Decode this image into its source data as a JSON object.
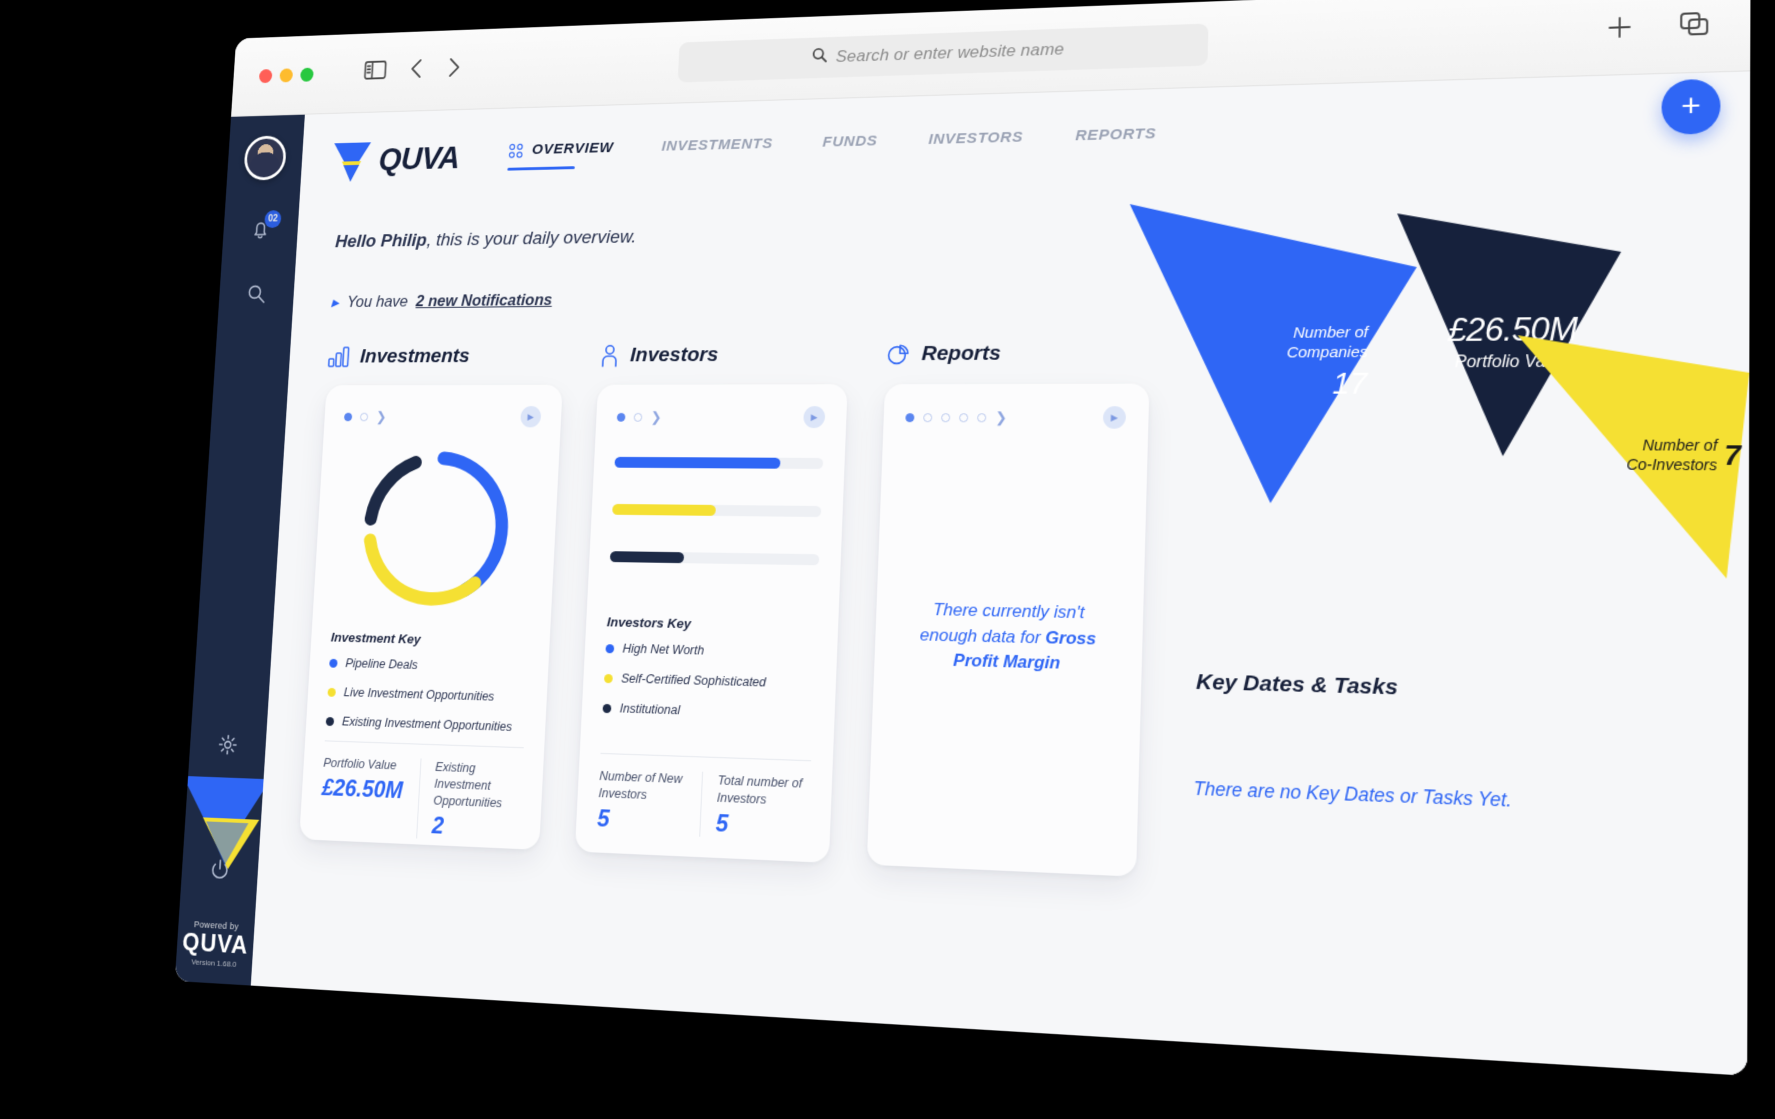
{
  "browser": {
    "search": {
      "placeholder": "Search or enter website name",
      "icon": "search-icon"
    },
    "sidebar_toggle_icon": "sidebar-toggle-icon",
    "back_icon": "chevron-left-icon",
    "forward_icon": "chevron-right-icon",
    "new_tab_icon": "plus-icon",
    "tab_overview_icon": "copy-tabs-icon"
  },
  "rail": {
    "avatar": "user-avatar",
    "notifications_badge": "02",
    "bell_icon": "bell-icon",
    "search_icon": "search-icon",
    "settings_icon": "gear-icon",
    "help_icon": "help-icon",
    "logout_icon": "logout-icon",
    "powered_by": "Powered by",
    "logo_name": "QUVA",
    "version": "Version 1.68.0"
  },
  "header": {
    "brand": "QUVA",
    "fab_label": "+",
    "tabs": [
      {
        "label": "OVERVIEW",
        "icon": "grid-icon",
        "active": true
      },
      {
        "label": "INVESTMENTS",
        "active": false
      },
      {
        "label": "FUNDS",
        "active": false
      },
      {
        "label": "INVESTORS",
        "active": false
      },
      {
        "label": "REPORTS",
        "active": false
      }
    ]
  },
  "greeting": {
    "name": "Hello Philip",
    "rest": ", this is your daily overview.",
    "notif_prefix": "You have ",
    "notif_link": "2 new Notifications"
  },
  "investments": {
    "title": "Investments",
    "icon": "bar-chart-icon",
    "carousel": {
      "dots": 2,
      "active": 0,
      "next_icon": "chevron-right-icon",
      "play_icon": "play-icon"
    },
    "legend_title": "Investment Key",
    "legend": [
      {
        "label": "Pipeline Deals",
        "color": "#2f66f5"
      },
      {
        "label": "Live Investment Opportunities",
        "color": "#f5e033"
      },
      {
        "label": "Existing Investment Opportunities",
        "color": "#1d2a46"
      }
    ],
    "stats": [
      {
        "label": "Portfolio Value",
        "value": "£26.50M"
      },
      {
        "label": "Existing Investment Opportunities",
        "value": "2"
      }
    ]
  },
  "investors": {
    "title": "Investors",
    "icon": "person-icon",
    "carousel": {
      "dots": 2,
      "active": 0,
      "next_icon": "chevron-right-icon",
      "play_icon": "play-icon"
    },
    "legend_title": "Investors Key",
    "legend": [
      {
        "label": "High Net Worth",
        "color": "#2f66f5"
      },
      {
        "label": "Self-Certified Sophisticated",
        "color": "#f5e033"
      },
      {
        "label": "Institutional",
        "color": "#1d2a46"
      }
    ],
    "stats": [
      {
        "label": "Number of New Investors",
        "value": "5"
      },
      {
        "label": "Total number of Investors",
        "value": "5"
      }
    ]
  },
  "reports": {
    "title": "Reports",
    "icon": "pie-chart-icon",
    "carousel": {
      "dots": 5,
      "active": 0,
      "next_icon": "chevron-right-icon",
      "play_icon": "play-icon"
    },
    "empty_prefix": "There currently isn't enough data for ",
    "empty_bold": "Gross Profit Margin"
  },
  "tiles": [
    {
      "name": "number-of-companies",
      "label": "Number of\nCompanies",
      "value": "17",
      "color": "#2f66f5"
    },
    {
      "name": "portfolio-value",
      "label": "Portfolio Value",
      "value": "£26.50M",
      "color": "#16213c"
    },
    {
      "name": "number-of-co-investors",
      "label": "Number of\nCo-Investors",
      "value": "7",
      "color": "#f5e033"
    }
  ],
  "key_dates": {
    "title": "Key Dates & Tasks",
    "empty": "There are no Key Dates or Tasks Yet."
  },
  "chart_data": [
    {
      "type": "pie",
      "title": "Investment Key",
      "labels": [
        "Pipeline Deals",
        "Live Investment Opportunities",
        "Existing Investment Opportunities"
      ],
      "values": [
        42,
        35,
        18
      ],
      "colors": [
        "#2f66f5",
        "#f5e033",
        "#1d2a46"
      ],
      "legend": "bottom",
      "note": "donut"
    },
    {
      "type": "bar",
      "title": "Investors Key",
      "categories": [
        "High Net Worth",
        "Self-Certified Sophisticated",
        "Institutional"
      ],
      "values": [
        80,
        50,
        36
      ],
      "colors": [
        "#2f66f5",
        "#f5e033",
        "#1d2a46"
      ],
      "xlabel": "",
      "ylabel": "",
      "ylim": [
        0,
        100
      ],
      "note": "horizontal bars on grey tracks"
    }
  ]
}
